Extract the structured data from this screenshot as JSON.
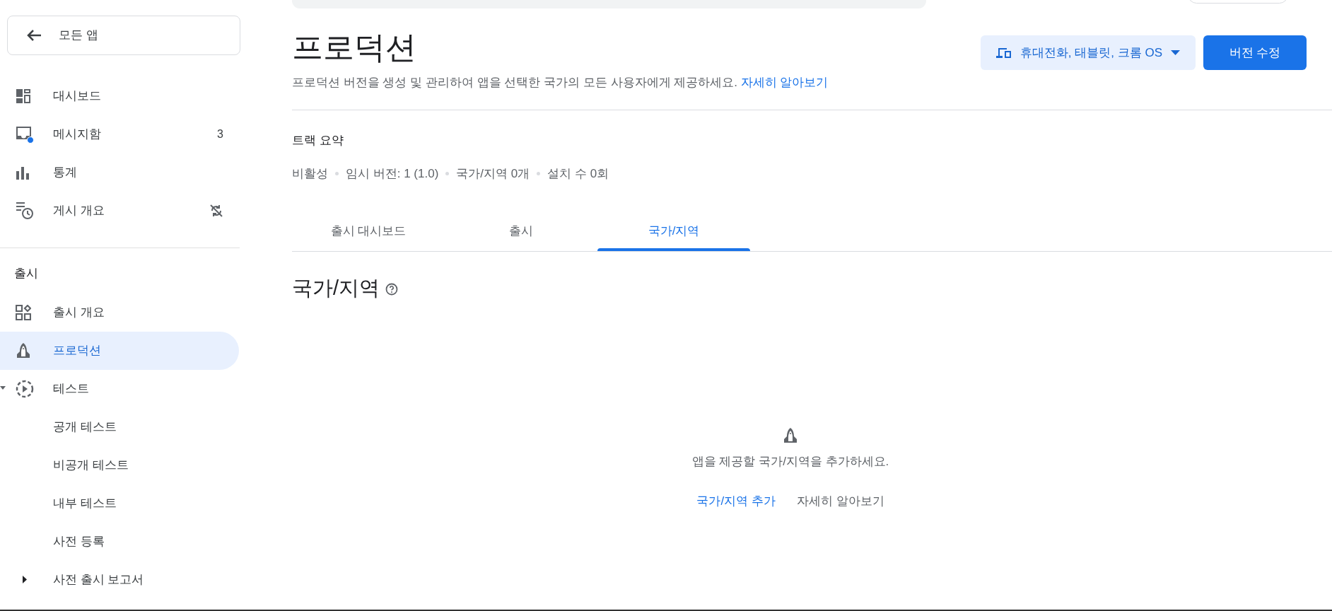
{
  "sidebar": {
    "back_button": "모든 앱",
    "items": [
      {
        "label": "대시보드",
        "selected": false
      },
      {
        "label": "메시지함",
        "badge": "3",
        "selected": false
      },
      {
        "label": "통계",
        "selected": false
      },
      {
        "label": "게시 개요",
        "selected": false
      }
    ],
    "section_title": "출시",
    "release_items": [
      {
        "label": "출시 개요",
        "selected": false
      },
      {
        "label": "프로덕션",
        "selected": true
      },
      {
        "label": "테스트",
        "expanded": true,
        "selected": false,
        "children": [
          {
            "label": "공개 테스트",
            "selected": false
          },
          {
            "label": "비공개 테스트",
            "selected": false
          },
          {
            "label": "내부 테스트",
            "selected": false
          }
        ]
      },
      {
        "label": "사전 등록",
        "selected": false
      },
      {
        "label": "사전 출시 보고서",
        "expanded": false,
        "selected": false
      }
    ]
  },
  "header": {
    "title": "프로덕션",
    "description": "프로덕션 버전을 생성 및 관리하여 앱을 선택한 국가의 모든 사용자에게 제공하세요.",
    "learn_more": "자세히 알아보기",
    "device_dropdown": "휴대전화, 태블릿, 크롬 OS",
    "edit_button": "버전 수정"
  },
  "track_summary": {
    "title": "트랙 요약",
    "items": [
      "비활성",
      "임시 버전: 1 (1.0)",
      "국가/지역 0개",
      "설치 수 0회"
    ]
  },
  "tabs": [
    {
      "label": "출시 대시보드",
      "selected": false
    },
    {
      "label": "출시",
      "selected": false
    },
    {
      "label": "국가/지역",
      "selected": true
    }
  ],
  "section": {
    "title": "국가/지역",
    "empty_message": "앱을 제공할 국가/지역을 추가하세요.",
    "add_link": "국가/지역 추가",
    "learn_more": "자세히 알아보기"
  }
}
